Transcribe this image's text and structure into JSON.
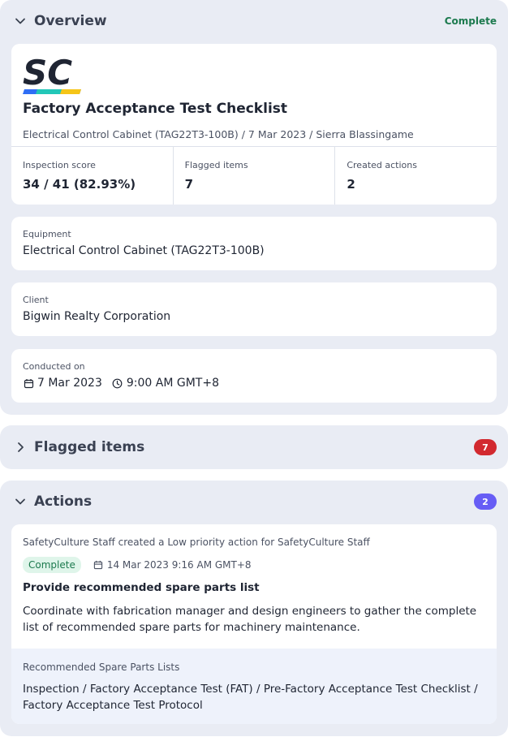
{
  "overview": {
    "title": "Overview",
    "status": "Complete",
    "report": {
      "logo_text": "SC",
      "title": "Factory Acceptance Test Checklist",
      "subtitle": "Electrical Control Cabinet (TAG22T3-100B) / 7 Mar 2023 / Sierra Blassingame",
      "stats": [
        {
          "label": "Inspection score",
          "value": "34 / 41 (82.93%)"
        },
        {
          "label": "Flagged items",
          "value": "7"
        },
        {
          "label": "Created actions",
          "value": "2"
        }
      ]
    },
    "equipment": {
      "label": "Equipment",
      "value": "Electrical Control Cabinet (TAG22T3-100B)"
    },
    "client": {
      "label": "Client",
      "value": "Bigwin Realty Corporation"
    },
    "conducted": {
      "label": "Conducted on",
      "date": "7 Mar 2023",
      "time": "9:00 AM GMT+8"
    }
  },
  "flagged": {
    "title": "Flagged items",
    "count": "7"
  },
  "actions": {
    "title": "Actions",
    "count": "2",
    "item": {
      "meta": "SafetyCulture Staff created a Low priority action for SafetyCulture Staff",
      "status": "Complete",
      "due": "14 Mar 2023 9:16 AM GMT+8",
      "title": "Provide recommended spare parts list",
      "description": "Coordinate with fabrication manager and design engineers to gather the complete list of recommended spare parts for machinery maintenance.",
      "source_label": "Recommended Spare Parts Lists",
      "source_path": "Inspection / Factory Acceptance Test (FAT) / Pre-Factory Acceptance Test Checklist / Factory Acceptance Test Protocol"
    }
  },
  "colors": {
    "status_green": "#1c7a4e",
    "badge_red": "#d2292f",
    "badge_blue": "#675df5",
    "section_bg": "#e9ecf4"
  },
  "icons": {
    "collapse": "chevron-down-icon",
    "expand": "chevron-right-icon",
    "date": "calendar-icon",
    "time": "clock-icon"
  }
}
